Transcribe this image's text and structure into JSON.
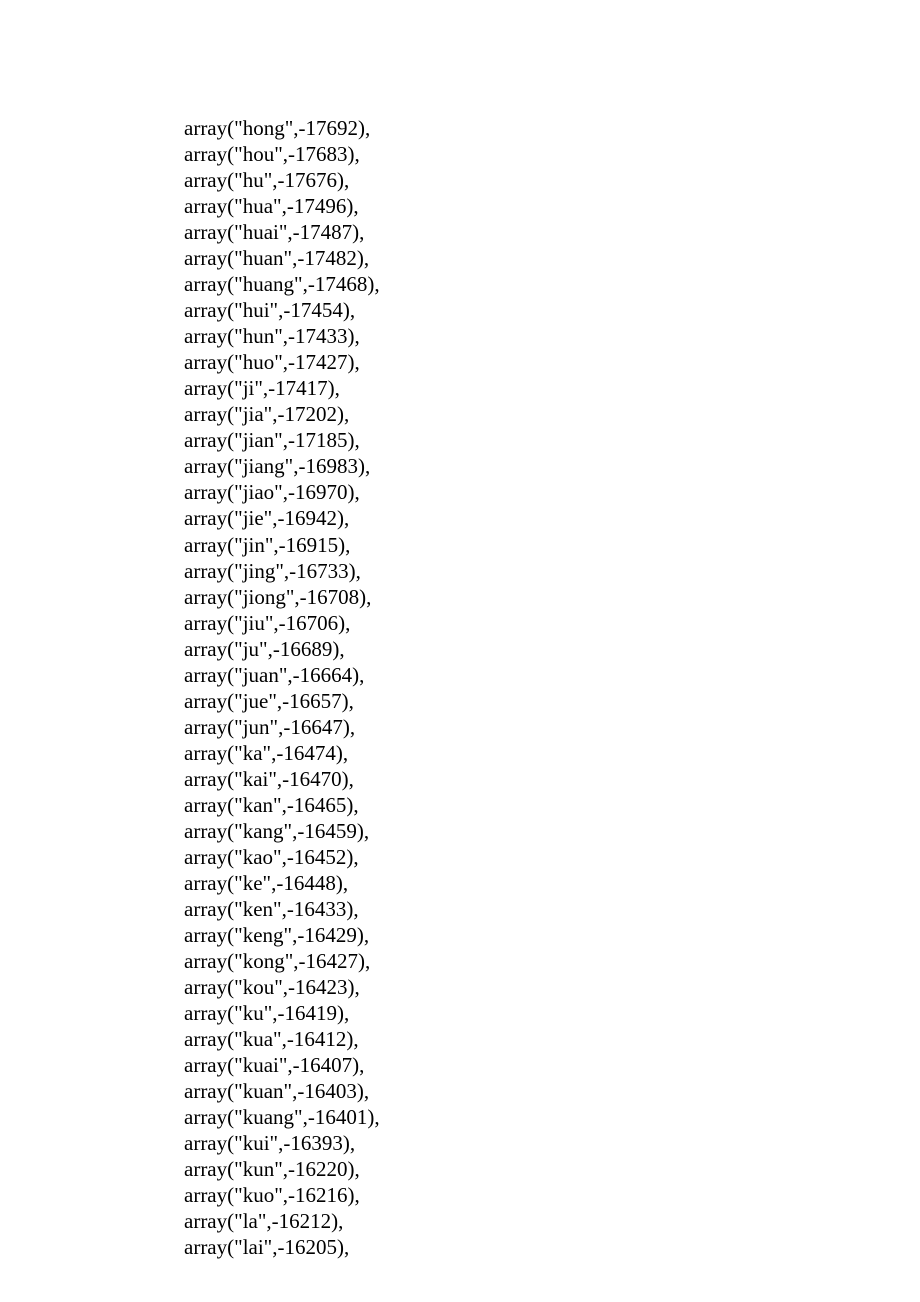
{
  "code_lines": [
    "array(\"hong\",-17692),",
    "array(\"hou\",-17683),",
    "array(\"hu\",-17676),",
    "array(\"hua\",-17496),",
    "array(\"huai\",-17487),",
    "array(\"huan\",-17482),",
    "array(\"huang\",-17468),",
    "array(\"hui\",-17454),",
    "array(\"hun\",-17433),",
    "array(\"huo\",-17427),",
    "array(\"ji\",-17417),",
    "array(\"jia\",-17202),",
    "array(\"jian\",-17185),",
    "array(\"jiang\",-16983),",
    "array(\"jiao\",-16970),",
    "array(\"jie\",-16942),",
    "array(\"jin\",-16915),",
    "array(\"jing\",-16733),",
    "array(\"jiong\",-16708),",
    "array(\"jiu\",-16706),",
    "array(\"ju\",-16689),",
    "array(\"juan\",-16664),",
    "array(\"jue\",-16657),",
    "array(\"jun\",-16647),",
    "array(\"ka\",-16474),",
    "array(\"kai\",-16470),",
    "array(\"kan\",-16465),",
    "array(\"kang\",-16459),",
    "array(\"kao\",-16452),",
    "array(\"ke\",-16448),",
    "array(\"ken\",-16433),",
    "array(\"keng\",-16429),",
    "array(\"kong\",-16427),",
    "array(\"kou\",-16423),",
    "array(\"ku\",-16419),",
    "array(\"kua\",-16412),",
    "array(\"kuai\",-16407),",
    "array(\"kuan\",-16403),",
    "array(\"kuang\",-16401),",
    "array(\"kui\",-16393),",
    "array(\"kun\",-16220),",
    "array(\"kuo\",-16216),",
    "array(\"la\",-16212),",
    "array(\"lai\",-16205),"
  ]
}
